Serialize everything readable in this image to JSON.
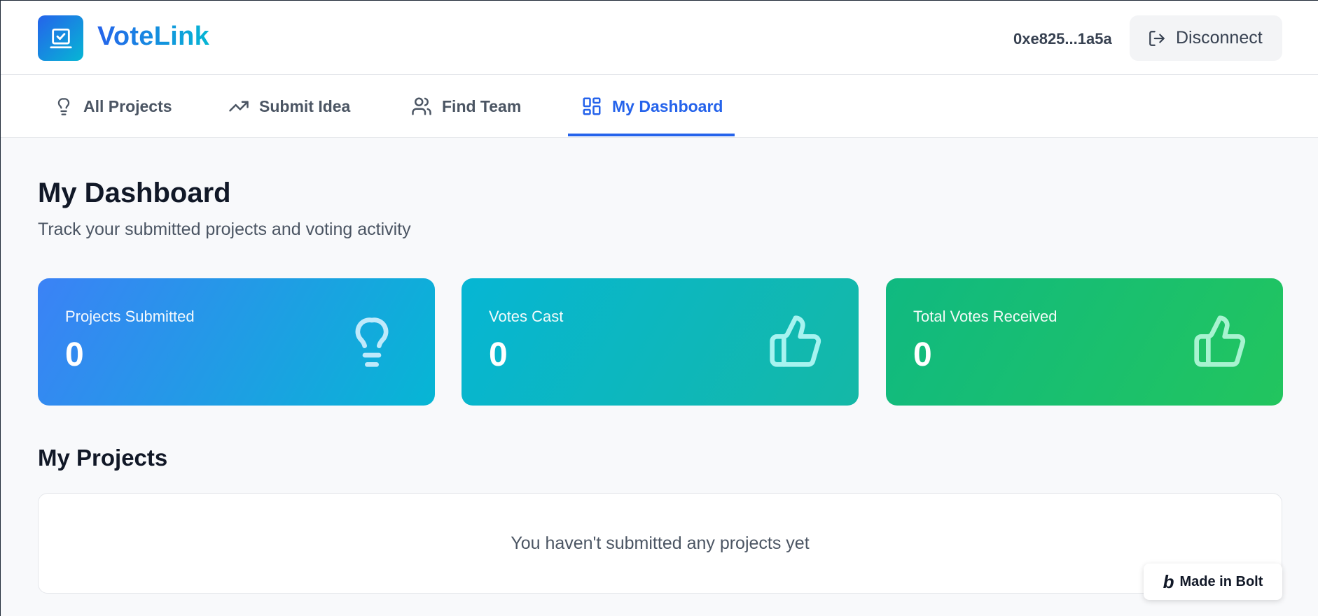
{
  "header": {
    "app_name": "VoteLink",
    "wallet_address": "0xe825...1a5a",
    "disconnect_label": "Disconnect"
  },
  "nav": {
    "tabs": [
      {
        "label": "All Projects",
        "icon": "lightbulb-icon",
        "active": false
      },
      {
        "label": "Submit Idea",
        "icon": "trending-up-icon",
        "active": false
      },
      {
        "label": "Find Team",
        "icon": "users-icon",
        "active": false
      },
      {
        "label": "My Dashboard",
        "icon": "dashboard-grid-icon",
        "active": true
      }
    ]
  },
  "main": {
    "title": "My Dashboard",
    "subtitle": "Track your submitted projects and voting activity",
    "stats": [
      {
        "label": "Projects Submitted",
        "value": "0",
        "icon": "lightbulb-icon"
      },
      {
        "label": "Votes Cast",
        "value": "0",
        "icon": "thumbs-up-icon"
      },
      {
        "label": "Total Votes Received",
        "value": "0",
        "icon": "thumbs-up-icon"
      }
    ],
    "projects_section": {
      "title": "My Projects",
      "empty_message": "You haven't submitted any projects yet"
    }
  },
  "badge": {
    "label": "Made in Bolt",
    "logo_letter": "b"
  },
  "colors": {
    "primary": "#2563eb",
    "accent": "#06b6d4",
    "success": "#22c55e"
  }
}
